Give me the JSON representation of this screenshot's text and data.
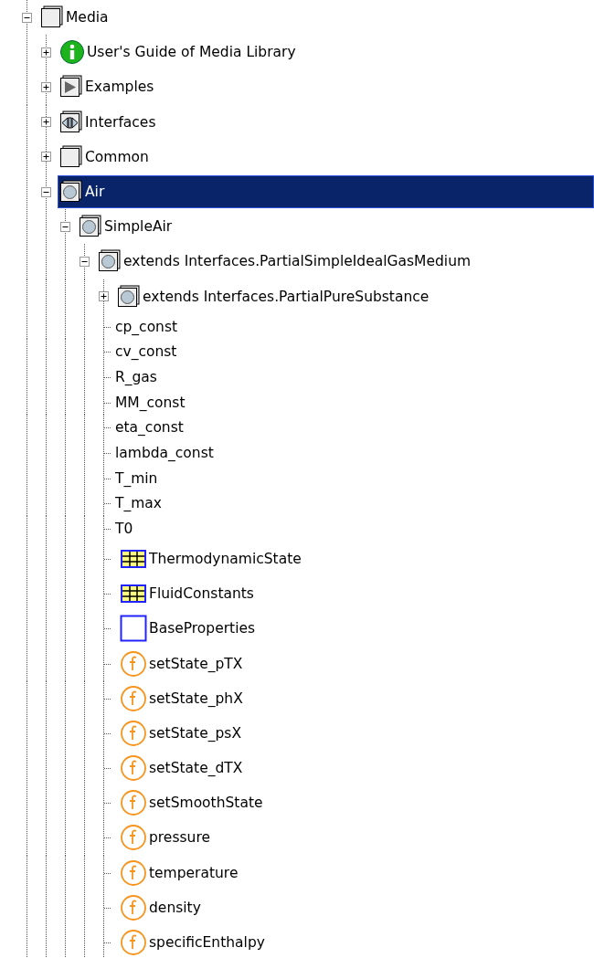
{
  "tree": [
    {
      "label": "Media",
      "kind": "package",
      "expanded": true,
      "selected": false,
      "children": [
        {
          "label": "User's Guide of Media Library",
          "kind": "info",
          "expanded": false,
          "selected": false
        },
        {
          "label": "Examples",
          "kind": "examples",
          "expanded": false,
          "selected": false
        },
        {
          "label": "Interfaces",
          "kind": "interfaces",
          "expanded": false,
          "selected": false
        },
        {
          "label": "Common",
          "kind": "package",
          "expanded": false,
          "selected": false
        },
        {
          "label": "Air",
          "kind": "medium",
          "expanded": true,
          "selected": true,
          "children": [
            {
              "label": "SimpleAir",
              "kind": "medium",
              "expanded": true,
              "selected": false,
              "children": [
                {
                  "label": "extends Interfaces.PartialSimpleIdealGasMedium",
                  "kind": "medium",
                  "expanded": true,
                  "selected": false,
                  "children": [
                    {
                      "label": "extends Interfaces.PartialPureSubstance",
                      "kind": "medium",
                      "expanded": false,
                      "selected": false
                    },
                    {
                      "label": "cp_const",
                      "kind": "variable",
                      "selected": false
                    },
                    {
                      "label": "cv_const",
                      "kind": "variable",
                      "selected": false
                    },
                    {
                      "label": "R_gas",
                      "kind": "variable",
                      "selected": false
                    },
                    {
                      "label": "MM_const",
                      "kind": "variable",
                      "selected": false
                    },
                    {
                      "label": "eta_const",
                      "kind": "variable",
                      "selected": false
                    },
                    {
                      "label": "lambda_const",
                      "kind": "variable",
                      "selected": false
                    },
                    {
                      "label": "T_min",
                      "kind": "variable",
                      "selected": false
                    },
                    {
                      "label": "T_max",
                      "kind": "variable",
                      "selected": false
                    },
                    {
                      "label": "T0",
                      "kind": "variable",
                      "selected": false
                    },
                    {
                      "label": "ThermodynamicState",
                      "kind": "record",
                      "selected": false
                    },
                    {
                      "label": "FluidConstants",
                      "kind": "record",
                      "selected": false
                    },
                    {
                      "label": "BaseProperties",
                      "kind": "model",
                      "selected": false
                    },
                    {
                      "label": "setState_pTX",
                      "kind": "function",
                      "selected": false
                    },
                    {
                      "label": "setState_phX",
                      "kind": "function",
                      "selected": false
                    },
                    {
                      "label": "setState_psX",
                      "kind": "function",
                      "selected": false
                    },
                    {
                      "label": "setState_dTX",
                      "kind": "function",
                      "selected": false
                    },
                    {
                      "label": "setSmoothState",
                      "kind": "function",
                      "selected": false
                    },
                    {
                      "label": "pressure",
                      "kind": "function",
                      "selected": false
                    },
                    {
                      "label": "temperature",
                      "kind": "function",
                      "selected": false
                    },
                    {
                      "label": "density",
                      "kind": "function",
                      "selected": false
                    },
                    {
                      "label": "specificEnthalpy",
                      "kind": "function",
                      "selected": false
                    }
                  ]
                }
              ]
            }
          ]
        }
      ]
    }
  ]
}
